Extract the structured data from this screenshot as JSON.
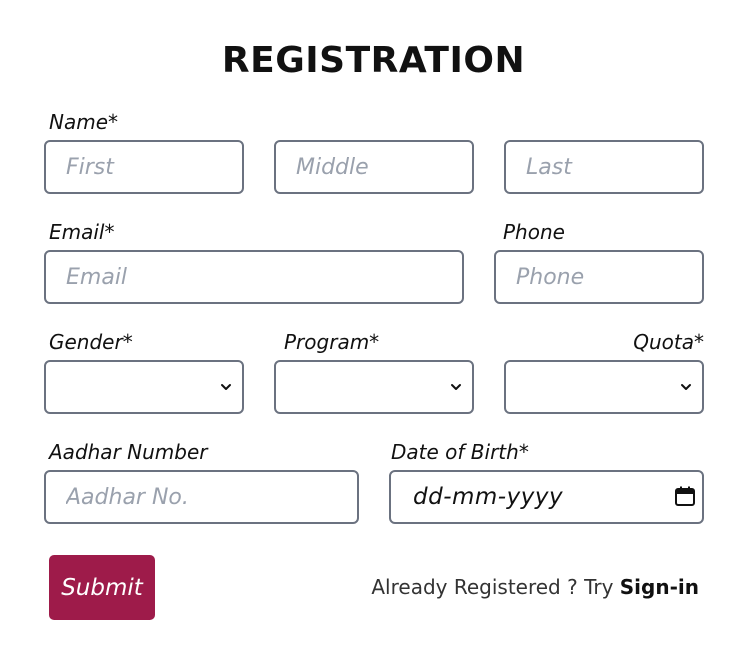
{
  "form": {
    "title": "REGISTRATION",
    "name": {
      "label": "Name*",
      "first_placeholder": "First",
      "middle_placeholder": "Middle",
      "last_placeholder": "Last"
    },
    "email": {
      "label": "Email*",
      "placeholder": "Email"
    },
    "phone": {
      "label": "Phone",
      "placeholder": "Phone"
    },
    "gender": {
      "label": "Gender*",
      "value": ""
    },
    "program": {
      "label": "Program*",
      "value": ""
    },
    "quota": {
      "label": "Quota*",
      "value": ""
    },
    "aadhar": {
      "label": "Aadhar Number",
      "placeholder": "Aadhar No."
    },
    "dob": {
      "label": "Date of Birth*",
      "placeholder": "dd-mm-yyyy"
    },
    "submit_label": "Submit",
    "signin": {
      "prompt": "Already Registered ? Try",
      "link": "Sign-in"
    }
  },
  "colors": {
    "accent": "#9e1b4a",
    "border": "#6b7280",
    "placeholder": "#9aa1ad"
  },
  "icons": {
    "dropdown": "chevron-down-icon",
    "date": "calendar-icon"
  }
}
